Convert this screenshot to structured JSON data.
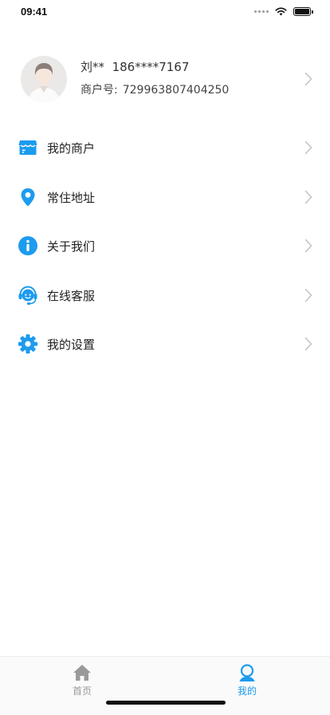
{
  "status_bar": {
    "time": "09:41"
  },
  "profile": {
    "name": "刘**",
    "phone": "186****7167",
    "merchant_label": "商户号:",
    "merchant_id": "729963807404250"
  },
  "menu": {
    "items": [
      {
        "label": "我的商户",
        "icon": "store-icon"
      },
      {
        "label": "常住地址",
        "icon": "location-pin-icon"
      },
      {
        "label": "关于我们",
        "icon": "info-icon"
      },
      {
        "label": "在线客服",
        "icon": "headset-icon"
      },
      {
        "label": "我的设置",
        "icon": "gear-icon"
      }
    ]
  },
  "tabbar": {
    "tabs": [
      {
        "label": "首页",
        "icon": "home-icon",
        "active": false
      },
      {
        "label": "我的",
        "icon": "user-icon",
        "active": true
      }
    ]
  },
  "colors": {
    "accent": "#1d9bef",
    "inactive": "#9a9a9a"
  }
}
